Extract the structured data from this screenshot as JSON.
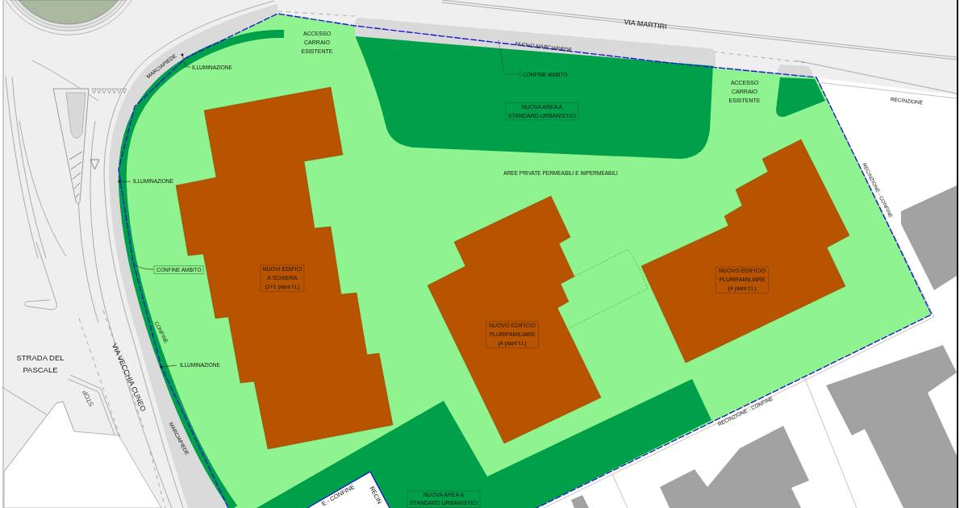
{
  "plan": {
    "streets": [
      {
        "lines": [
          "VIA MARTIRI"
        ]
      },
      {
        "lines": [
          "STRADA DEL",
          "PASCALE"
        ]
      },
      {
        "lines": [
          "VIA VECCHIA CUNEO"
        ]
      }
    ],
    "road_markings": [
      {
        "text": "STOP"
      }
    ],
    "accesses": [
      {
        "lines": [
          "ACCESSO",
          "CARRAIO",
          "ESISTENTE"
        ]
      },
      {
        "lines": [
          "ACCESSO",
          "CARRAIO",
          "ESISTENTE"
        ]
      }
    ],
    "areas": [
      {
        "kind": "standard",
        "lines": [
          "NUOVA AREA A",
          "STANDARD URBANISTICI"
        ]
      },
      {
        "kind": "private",
        "lines": [
          "AREE PRIVATE PERMEABILI E IMPERMEABILI"
        ]
      },
      {
        "kind": "standard",
        "lines": [
          "NUOVA AREA A",
          "STANDARD URBANISTICI"
        ]
      }
    ],
    "buildings": [
      {
        "lines": [
          "NUOVI EDIFICI",
          "A SCHIERA",
          "(2+1 piani f.t.)"
        ]
      },
      {
        "lines": [
          "NUOVO EDIFICIO",
          "PLURIFAMILIARE",
          "(4 piani f.t.)"
        ]
      },
      {
        "lines": [
          "NUOVO EDIFICIO",
          "PLURIFAMILIARE",
          "(4 piani f.t.)"
        ]
      }
    ],
    "annotations": [
      {
        "kind": "leader",
        "text": "ILLUMINAZIONE"
      },
      {
        "kind": "edge",
        "text": "MARCIAPIEDE"
      },
      {
        "kind": "edge",
        "text": "NUOVO MARCIAPIEDE"
      },
      {
        "kind": "leader",
        "text": "CONFINE AMBITO"
      },
      {
        "kind": "edge",
        "text": "RECINZIONE"
      },
      {
        "kind": "leader",
        "text": "ILLUMINAZIONE"
      },
      {
        "kind": "edge",
        "text": "RECINZIONE - CONFINE"
      },
      {
        "kind": "framed_leader",
        "text": "CONFINE AMBITO"
      },
      {
        "kind": "edge",
        "text": "CONFINE"
      },
      {
        "kind": "leader",
        "text": "ILLUMINAZIONE"
      },
      {
        "kind": "edge",
        "text": "RECINZIONE - CONFINE"
      },
      {
        "kind": "edge",
        "text": "MARCIAPIEDE"
      },
      {
        "kind": "edge",
        "text": "E - CONFINE"
      },
      {
        "kind": "edge",
        "text": "RECIN"
      }
    ]
  }
}
